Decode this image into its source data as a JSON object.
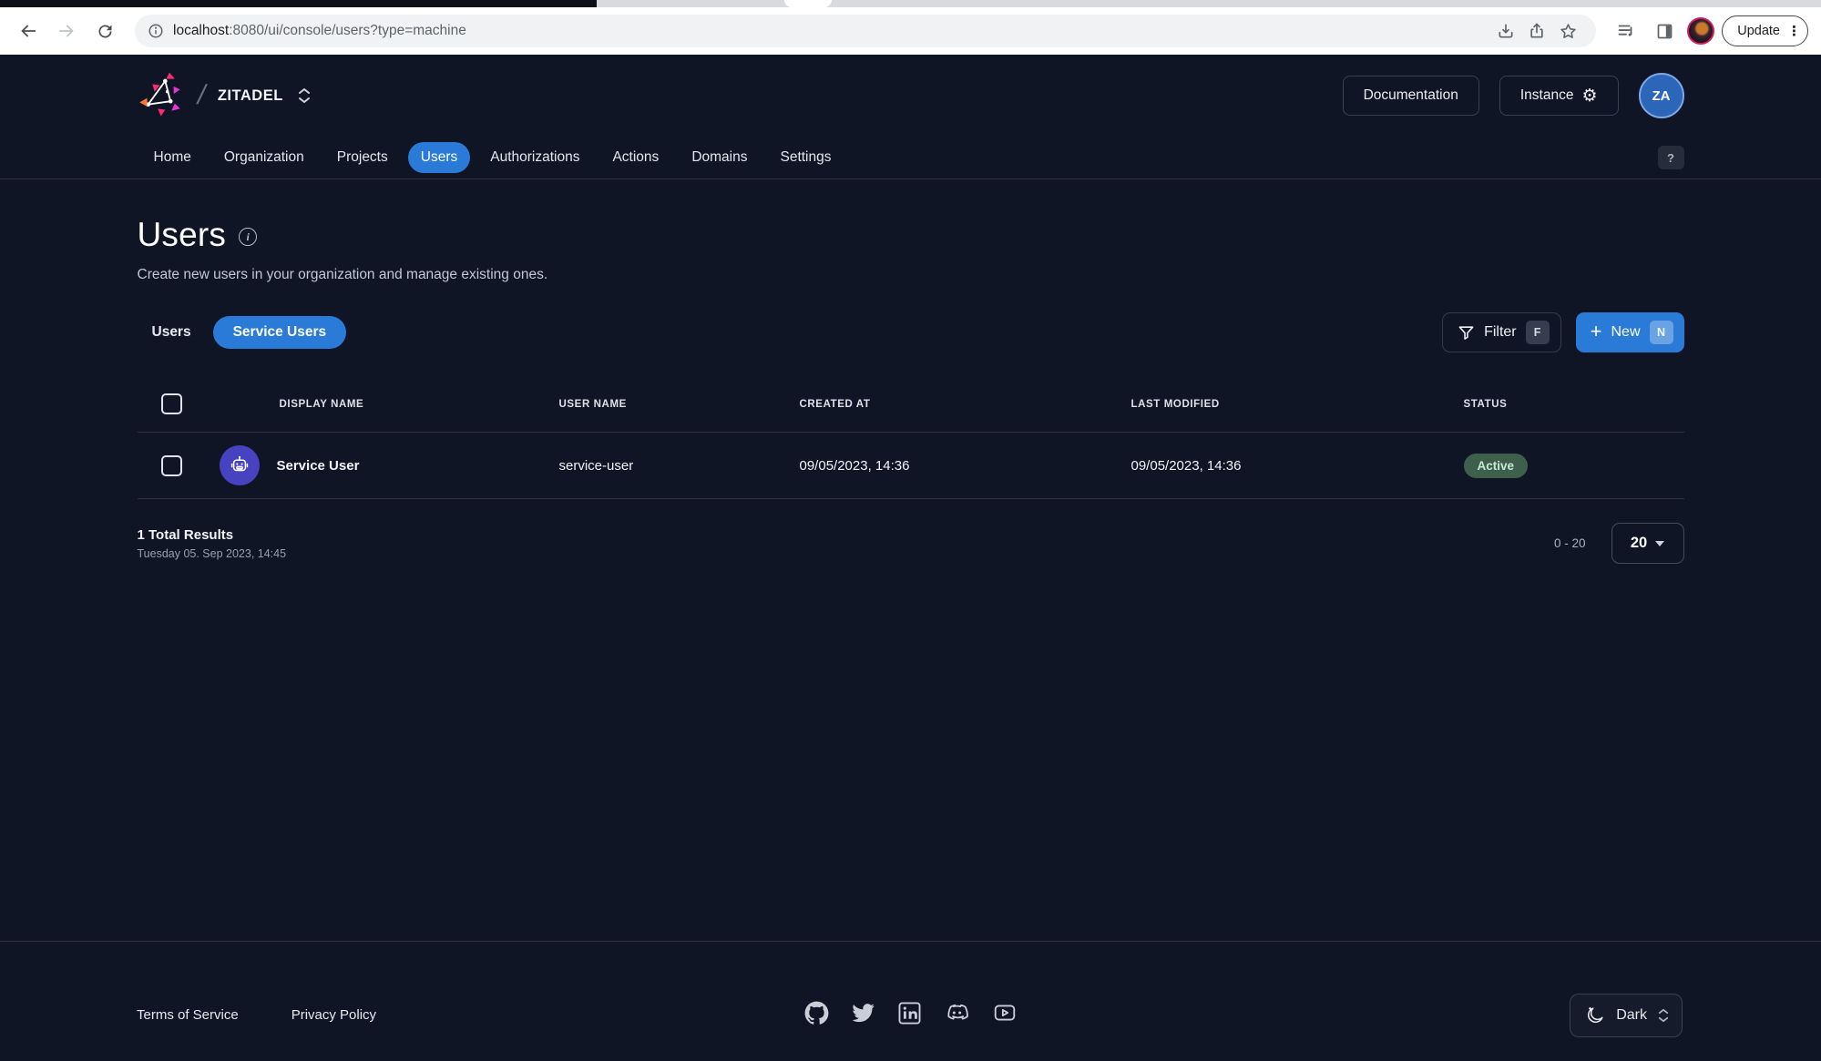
{
  "browser": {
    "url_host": "localhost",
    "url_rest": ":8080/ui/console/users?type=machine",
    "update_label": "Update"
  },
  "header": {
    "org_name": "ZITADEL",
    "documentation_label": "Documentation",
    "instance_label": "Instance",
    "gear_glyph": "⚙",
    "avatar_initials": "ZA",
    "help_label": "?"
  },
  "nav": {
    "items": [
      {
        "label": "Home",
        "active": false
      },
      {
        "label": "Organization",
        "active": false
      },
      {
        "label": "Projects",
        "active": false
      },
      {
        "label": "Users",
        "active": true
      },
      {
        "label": "Authorizations",
        "active": false
      },
      {
        "label": "Actions",
        "active": false
      },
      {
        "label": "Domains",
        "active": false
      },
      {
        "label": "Settings",
        "active": false
      }
    ]
  },
  "page": {
    "title": "Users",
    "subtitle": "Create new users in your organization and manage existing ones.",
    "tab_users": "Users",
    "tab_service_users": "Service Users",
    "filter_label": "Filter",
    "filter_shortcut": "F",
    "new_label": "New",
    "new_plus": "+",
    "new_shortcut": "N"
  },
  "table": {
    "columns": [
      "DISPLAY NAME",
      "USER NAME",
      "CREATED AT",
      "LAST MODIFIED",
      "STATUS"
    ],
    "rows": [
      {
        "display_name": "Service User",
        "user_name": "service-user",
        "created_at": "09/05/2023, 14:36",
        "last_modified": "09/05/2023, 14:36",
        "status": "Active"
      }
    ]
  },
  "pagination": {
    "total": "1 Total Results",
    "timestamp": "Tuesday 05. Sep 2023, 14:45",
    "range": "0 - 20",
    "page_size": "20"
  },
  "footer": {
    "terms": "Terms of Service",
    "privacy": "Privacy Policy",
    "theme_label": "Dark"
  },
  "colors": {
    "app_background": "#101526",
    "primary_blue": "#2a7bd8",
    "active_badge_bg": "#3f5f4d",
    "active_badge_text": "#c7e8d2",
    "robot_avatar_bg": "#4743c0",
    "user_avatar_bg": "#2c66b8"
  }
}
